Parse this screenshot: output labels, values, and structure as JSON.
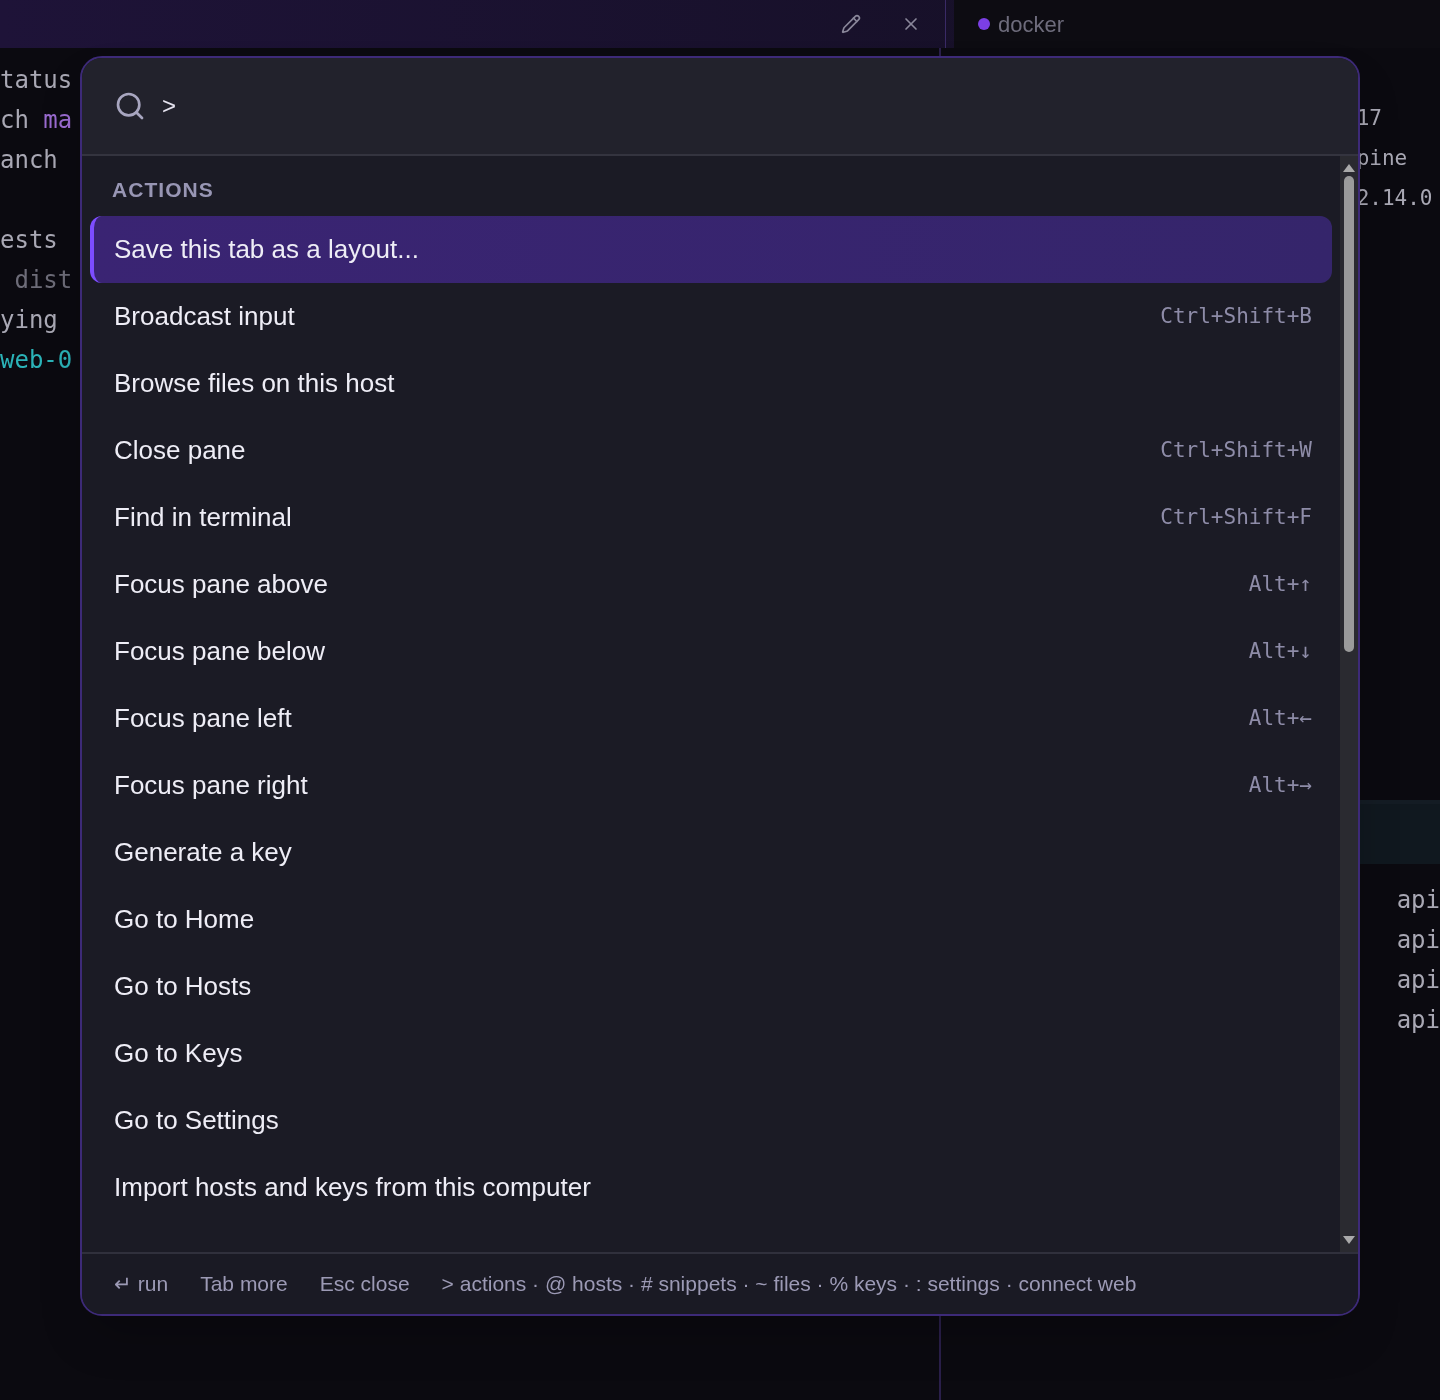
{
  "top_bar": {
    "tab": {
      "title": "docker",
      "color": "#7b3fe4"
    }
  },
  "left_pane": {
    "blocks": [
      [
        {
          "text": "tatus",
          "color": "#a9a8b4"
        },
        {
          "text": "ch ",
          "color": "#a9a8b4",
          "accent": "ma"
        },
        {
          "text": "anch",
          "color": "#a9a8b4"
        }
      ],
      [
        {
          "text": "ests",
          "color": "#a9a8b4"
        },
        {
          "text": " dist",
          "color": "#6d6c78"
        },
        {
          "text": "ying",
          "color": "#a9a8b4"
        },
        {
          "text": "web-0",
          "color": "#2bb3b8"
        }
      ]
    ]
  },
  "right_pane": {
    "lines": [
      "17",
      "pine",
      "2.14.0"
    ],
    "log_lines": [
      "api",
      "api",
      "api",
      "api"
    ]
  },
  "palette": {
    "query": ">",
    "section": "ACTIONS",
    "items": [
      {
        "label": "Save this tab as a layout...",
        "selected": true
      },
      {
        "label": "Broadcast input",
        "shortcut": "Ctrl+Shift+B",
        "selected": false
      },
      {
        "label": "Browse files on this host",
        "selected": false
      },
      {
        "label": "Close pane",
        "shortcut": "Ctrl+Shift+W",
        "selected": false
      },
      {
        "label": "Find in terminal",
        "shortcut": "Ctrl+Shift+F",
        "selected": false
      },
      {
        "label": "Focus pane above",
        "shortcut": "Alt+↑",
        "selected": false
      },
      {
        "label": "Focus pane below",
        "shortcut": "Alt+↓",
        "selected": false
      },
      {
        "label": "Focus pane left",
        "shortcut": "Alt+←",
        "selected": false
      },
      {
        "label": "Focus pane right",
        "shortcut": "Alt+→",
        "selected": false
      },
      {
        "label": "Generate a key",
        "selected": false
      },
      {
        "label": "Go to Home",
        "selected": false
      },
      {
        "label": "Go to Hosts",
        "selected": false
      },
      {
        "label": "Go to Keys",
        "selected": false
      },
      {
        "label": "Go to Settings",
        "selected": false
      },
      {
        "label": "Import hosts and keys from this computer",
        "selected": false
      }
    ],
    "footer": {
      "hints": [
        "↵ run",
        "Tab more",
        "Esc close"
      ],
      "prefixes": "> actions · @ hosts · # snippets · ~ files · % keys · : settings · connect web"
    }
  }
}
